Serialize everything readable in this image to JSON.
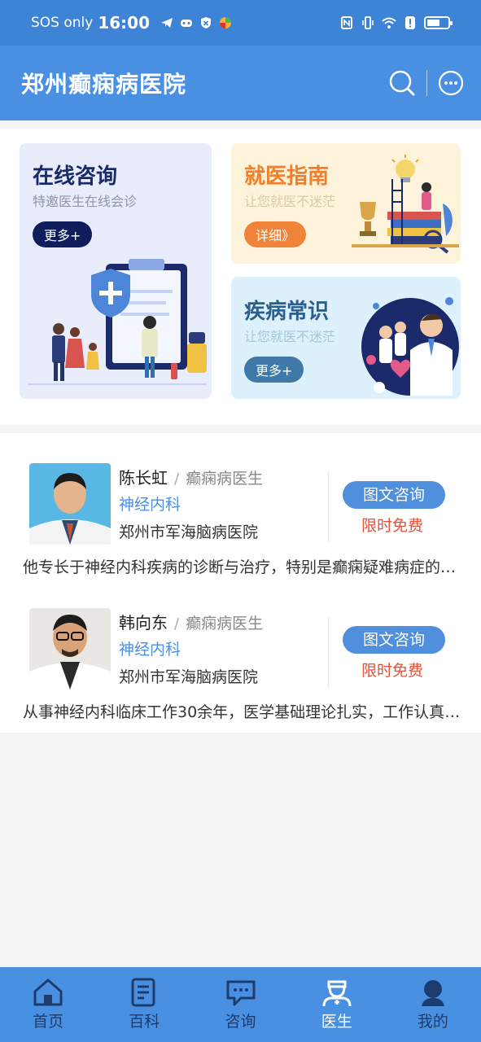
{
  "status_bar": {
    "carrier": "SOS only",
    "time": "16:00"
  },
  "header": {
    "title": "郑州癫痫病医院",
    "icons": [
      "search-icon",
      "more-icon"
    ]
  },
  "cards": {
    "online": {
      "title": "在线咨询",
      "subtitle": "特邀医生在线会诊",
      "button": "更多+"
    },
    "guide": {
      "title": "就医指南",
      "subtitle": "让您就医不迷茫",
      "button": "详细》"
    },
    "knowledge": {
      "title": "疾病常识",
      "subtitle": "让您就医不迷茫",
      "button": "更多+"
    }
  },
  "doctors": [
    {
      "name": "陈长虹",
      "separator": "/",
      "role": "癫痫病医生",
      "department": "神经内科",
      "hospital": "郑州市军海脑病医院",
      "consult_label": "图文咨询",
      "price_label": "限时免费",
      "description": "他专长于神经内科疾病的诊断与治疗，特别是癫痫疑难病症的诊治"
    },
    {
      "name": "韩向东",
      "separator": "/",
      "role": "癫痫病医生",
      "department": "神经内科",
      "hospital": "郑州市军海脑病医院",
      "consult_label": "图文咨询",
      "price_label": "限时免费",
      "description": "从事神经内科临床工作30余年，医学基础理论扎实，工作认真负责"
    }
  ],
  "tabbar": {
    "items": [
      {
        "label": "首页",
        "icon": "home-icon"
      },
      {
        "label": "百科",
        "icon": "encyclopedia-icon"
      },
      {
        "label": "咨询",
        "icon": "chat-icon"
      },
      {
        "label": "医生",
        "icon": "doctor-icon"
      },
      {
        "label": "我的",
        "icon": "profile-icon"
      }
    ],
    "active_index": 3
  },
  "colors": {
    "brand": "#4a90e2",
    "status_bar": "#3d83d6",
    "free_red": "#e2533c"
  }
}
